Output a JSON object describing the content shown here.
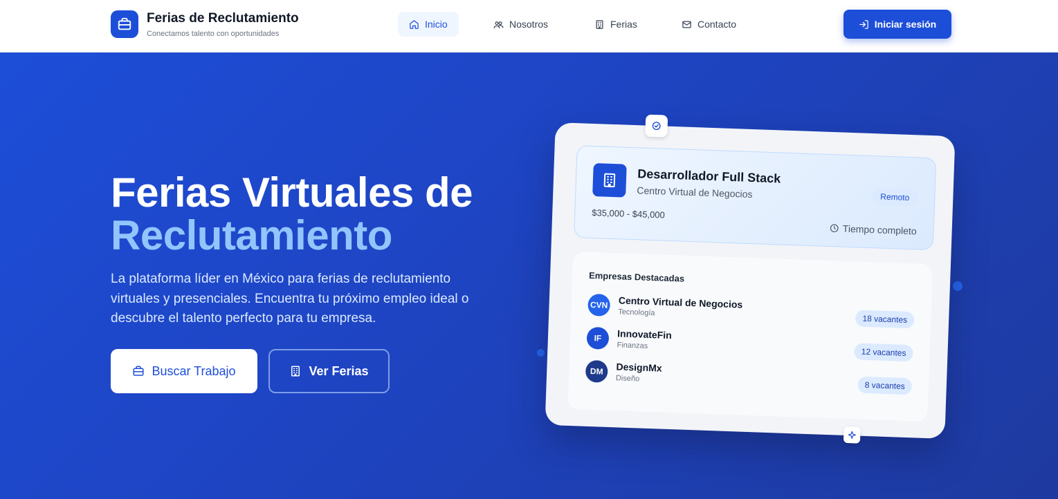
{
  "header": {
    "brand_title": "Ferias de Reclutamiento",
    "brand_subtitle": "Conectamos talento con oportunidades",
    "nav": [
      {
        "label": "Inicio",
        "icon": "home-icon",
        "active": true
      },
      {
        "label": "Nosotros",
        "icon": "users-icon",
        "active": false
      },
      {
        "label": "Ferias",
        "icon": "building-icon",
        "active": false
      },
      {
        "label": "Contacto",
        "icon": "mail-icon",
        "active": false
      }
    ],
    "login_label": "Iniciar sesión"
  },
  "hero": {
    "title_line1": "Ferias Virtuales de",
    "title_line2": "Reclutamiento",
    "description": "La plataforma líder en México para ferias de reclutamiento virtuales y presenciales. Encuentra tu próximo empleo ideal o descubre el talento perfecto para tu empresa.",
    "primary_button": "Buscar Trabajo",
    "secondary_button": "Ver Ferias"
  },
  "card": {
    "job": {
      "title": "Desarrollador Full Stack",
      "company": "Centro Virtual de Negocios",
      "tag": "Remoto",
      "salary": "$35,000 - $45,000",
      "type": "Tiempo completo"
    },
    "featured_title": "Empresas Destacadas",
    "companies": [
      {
        "initials": "CVN",
        "name": "Centro Virtual de Negocios",
        "category": "Tecnología",
        "vacancies": "18 vacantes",
        "color": "#2563eb"
      },
      {
        "initials": "IF",
        "name": "InnovateFin",
        "category": "Finanzas",
        "vacancies": "12 vacantes",
        "color": "#1d4ed8"
      },
      {
        "initials": "DM",
        "name": "DesignMx",
        "category": "Diseño",
        "vacancies": "8 vacantes",
        "color": "#1e3a8a"
      }
    ]
  },
  "colors": {
    "primary": "#1d4ed8",
    "accent": "#93c5fd"
  }
}
